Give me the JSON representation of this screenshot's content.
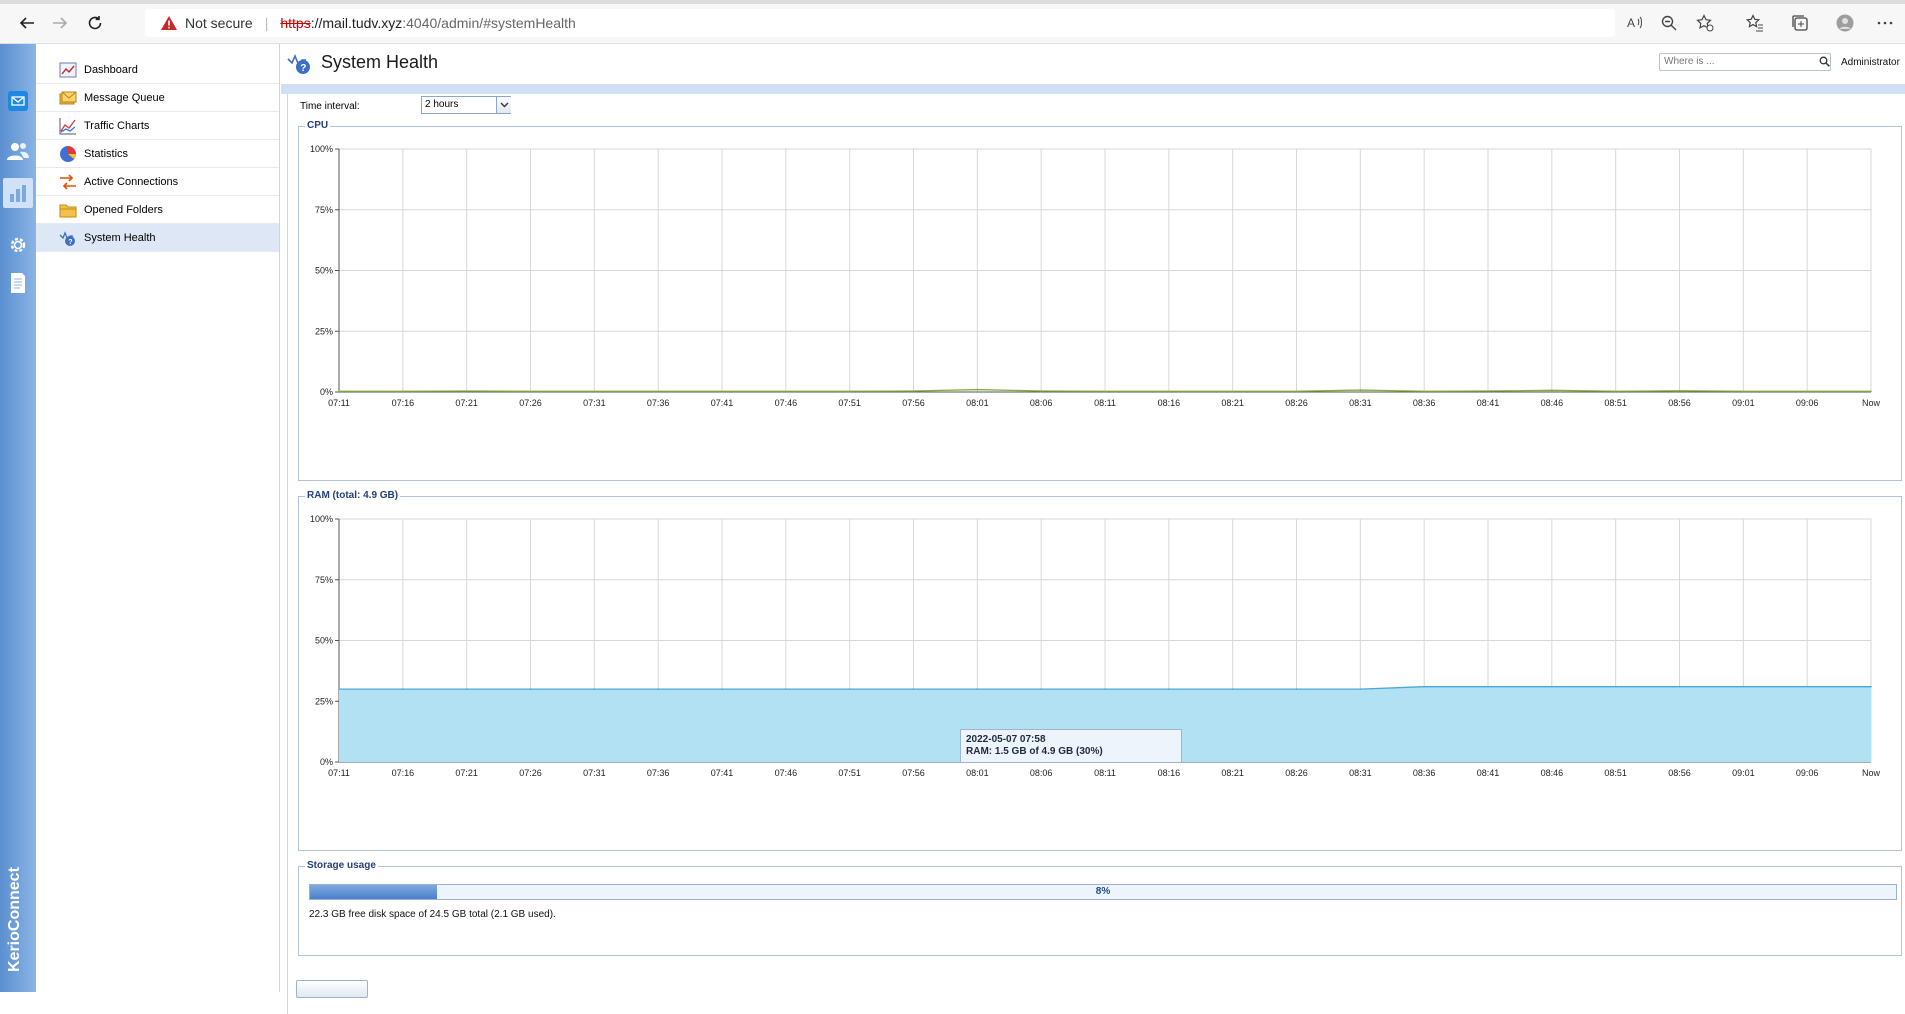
{
  "browser": {
    "security_label": "Not secure",
    "url_protocol": "https",
    "url_host": "://mail.tudv.xyz",
    "url_rest": ":4040/admin/#systemHealth"
  },
  "app": {
    "brand": "KerioConnect"
  },
  "sidebar": {
    "items": [
      {
        "label": "Dashboard",
        "icon": "dashboard-icon"
      },
      {
        "label": "Message Queue",
        "icon": "message-queue-icon"
      },
      {
        "label": "Traffic Charts",
        "icon": "traffic-charts-icon"
      },
      {
        "label": "Statistics",
        "icon": "statistics-icon"
      },
      {
        "label": "Active Connections",
        "icon": "active-connections-icon"
      },
      {
        "label": "Opened Folders",
        "icon": "folder-icon"
      },
      {
        "label": "System Health",
        "icon": "system-health-icon",
        "active": true
      }
    ]
  },
  "header": {
    "title": "System Health",
    "search_placeholder": "Where is ...",
    "user": "Administrator"
  },
  "controls": {
    "time_interval_label": "Time interval:",
    "time_interval_value": "2 hours"
  },
  "charts": {
    "cpu": {
      "legend": "CPU",
      "y_ticks": [
        "100%",
        "75%",
        "50%",
        "25%",
        "0%"
      ],
      "x_ticks": [
        "07:11",
        "07:16",
        "07:21",
        "07:26",
        "07:31",
        "07:36",
        "07:41",
        "07:46",
        "07:51",
        "07:56",
        "08:01",
        "08:06",
        "08:11",
        "08:16",
        "08:21",
        "08:26",
        "08:31",
        "08:36",
        "08:41",
        "08:46",
        "08:51",
        "08:56",
        "09:01",
        "09:06",
        "Now"
      ]
    },
    "ram": {
      "legend": "RAM (total: 4.9 GB)",
      "y_ticks": [
        "100%",
        "75%",
        "50%",
        "25%",
        "0%"
      ],
      "x_ticks": [
        "07:11",
        "07:16",
        "07:21",
        "07:26",
        "07:31",
        "07:36",
        "07:41",
        "07:46",
        "07:51",
        "07:56",
        "08:01",
        "08:06",
        "08:11",
        "08:16",
        "08:21",
        "08:26",
        "08:31",
        "08:36",
        "08:41",
        "08:46",
        "08:51",
        "08:56",
        "09:01",
        "09:06",
        "Now"
      ],
      "tooltip_line1": "2022-05-07 07:58",
      "tooltip_line2": "RAM: 1.5 GB of 4.9 GB (30%)"
    }
  },
  "storage": {
    "legend": "Storage usage",
    "percent_label": "8%",
    "percent": 8,
    "summary": "22.3 GB free disk space of 24.5 GB total (2.1 GB used)."
  },
  "colors": {
    "cpu_line": "#7fb13a",
    "ram_fill": "#b3e1f4",
    "ram_line": "#4aa8d6"
  },
  "chart_data": [
    {
      "type": "line",
      "title": "CPU",
      "x": [
        "07:11",
        "07:16",
        "07:21",
        "07:26",
        "07:31",
        "07:36",
        "07:41",
        "07:46",
        "07:51",
        "07:56",
        "08:01",
        "08:06",
        "08:11",
        "08:16",
        "08:21",
        "08:26",
        "08:31",
        "08:36",
        "08:41",
        "08:46",
        "08:51",
        "08:56",
        "09:01",
        "09:06",
        "Now"
      ],
      "series": [
        {
          "values": [
            0.3,
            0.3,
            0.4,
            0.3,
            0.3,
            0.3,
            0.3,
            0.3,
            0.3,
            0.4,
            1.0,
            0.4,
            0.3,
            0.3,
            0.3,
            0.3,
            0.8,
            0.3,
            0.4,
            0.7,
            0.3,
            0.5,
            0.3,
            0.3,
            0.3
          ]
        }
      ],
      "ylim": [
        0,
        100
      ],
      "grid": true
    },
    {
      "type": "area",
      "title": "RAM (total: 4.9 GB)",
      "x": [
        "07:11",
        "07:16",
        "07:21",
        "07:26",
        "07:31",
        "07:36",
        "07:41",
        "07:46",
        "07:51",
        "07:56",
        "08:01",
        "08:06",
        "08:11",
        "08:16",
        "08:21",
        "08:26",
        "08:31",
        "08:36",
        "08:41",
        "08:46",
        "08:51",
        "08:56",
        "09:01",
        "09:06",
        "Now"
      ],
      "series": [
        {
          "values": [
            30,
            30,
            30,
            30,
            30,
            30,
            30,
            30,
            30,
            30,
            30,
            30,
            30,
            30,
            30,
            30,
            30,
            31,
            31,
            31,
            31,
            31,
            31,
            31,
            31
          ]
        }
      ],
      "ylim": [
        0,
        100
      ],
      "grid": true
    }
  ]
}
